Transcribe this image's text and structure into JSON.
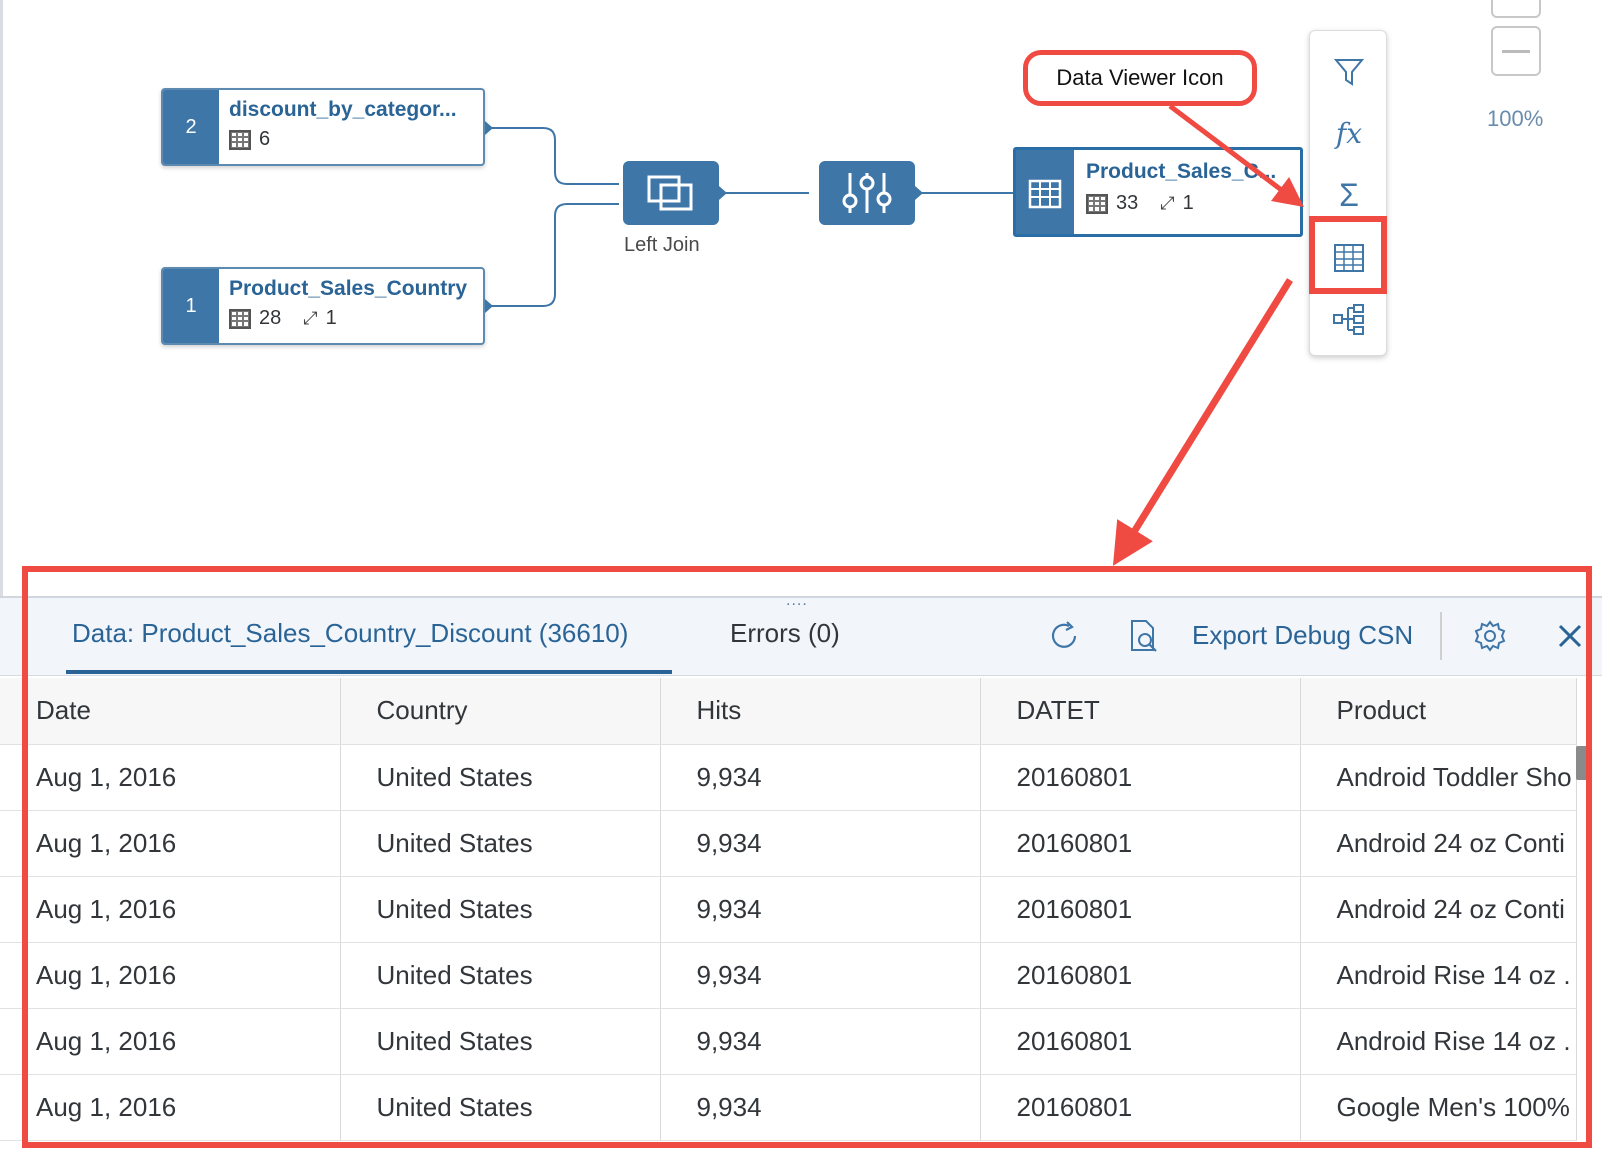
{
  "flow": {
    "node_discount": {
      "index": "2",
      "title": "discount_by_categor...",
      "columns": "6"
    },
    "node_sales": {
      "index": "1",
      "title": "Product_Sales_Country",
      "columns": "28",
      "links": "1"
    },
    "join": {
      "label": "Left Join"
    },
    "target": {
      "title": "Product_Sales_C...",
      "columns": "33",
      "links": "1"
    }
  },
  "zoom": {
    "level": "100%"
  },
  "callout": {
    "text": "Data Viewer Icon"
  },
  "toolbar": {
    "icons": [
      "filter-icon",
      "formula-icon",
      "sum-icon",
      "data-viewer-icon",
      "hierarchy-icon"
    ]
  },
  "panel": {
    "tab_data": "Data: Product_Sales_Country_Discount (36610)",
    "tab_errors": "Errors (0)",
    "export_label": "Export Debug CSN",
    "drag_handle": "....",
    "columns": [
      "Date",
      "Country",
      "Hits",
      "DATET",
      "Product"
    ],
    "rows": [
      [
        "Aug 1, 2016",
        "United States",
        "9,934",
        "20160801",
        "Android Toddler Sho"
      ],
      [
        "Aug 1, 2016",
        "United States",
        "9,934",
        "20160801",
        "Android 24 oz Conti"
      ],
      [
        "Aug 1, 2016",
        "United States",
        "9,934",
        "20160801",
        "Android 24 oz Conti"
      ],
      [
        "Aug 1, 2016",
        "United States",
        "9,934",
        "20160801",
        "Android Rise 14 oz ."
      ],
      [
        "Aug 1, 2016",
        "United States",
        "9,934",
        "20160801",
        "Android Rise 14 oz ."
      ],
      [
        "Aug 1, 2016",
        "United States",
        "9,934",
        "20160801",
        "Google Men's 100%"
      ]
    ]
  },
  "colors": {
    "accent": "#3f76a8",
    "link": "#2a6496",
    "highlight": "#ef4b43"
  }
}
